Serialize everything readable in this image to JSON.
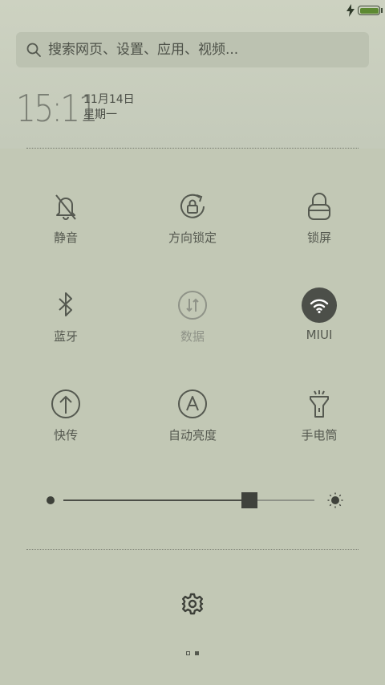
{
  "status_bar": {
    "charging_icon": "lightning-bolt-icon",
    "battery_level_percent": 100,
    "battery_color": "#5d8a32"
  },
  "search": {
    "placeholder": "搜索网页、设置、应用、视频...",
    "icon": "search-icon"
  },
  "clock": {
    "time": "15:11",
    "date": "11月14日",
    "weekday": "星期一"
  },
  "toggles": [
    {
      "id": "silent",
      "label": "静音",
      "icon": "bell-off-icon",
      "enabled": true
    },
    {
      "id": "rotation-lock",
      "label": "方向锁定",
      "icon": "rotation-lock-icon",
      "enabled": true
    },
    {
      "id": "lock-screen",
      "label": "锁屏",
      "icon": "padlock-icon",
      "enabled": true
    },
    {
      "id": "bluetooth",
      "label": "蓝牙",
      "icon": "bluetooth-icon",
      "enabled": true
    },
    {
      "id": "mobile-data",
      "label": "数据",
      "icon": "data-arrows-icon",
      "enabled": false
    },
    {
      "id": "wifi",
      "label": "MIUI",
      "icon": "wifi-icon",
      "enabled": true,
      "active": true
    },
    {
      "id": "quick-transfer",
      "label": "快传",
      "icon": "upload-arrow-icon",
      "enabled": true
    },
    {
      "id": "auto-brightness",
      "label": "自动亮度",
      "icon": "auto-brightness-icon",
      "enabled": true
    },
    {
      "id": "flashlight",
      "label": "手电筒",
      "icon": "flashlight-icon",
      "enabled": true
    }
  ],
  "brightness": {
    "level_percent": 74,
    "low_icon": "brightness-low-icon",
    "high_icon": "sun-icon"
  },
  "settings": {
    "icon": "gear-icon"
  },
  "pager": {
    "pages": 2,
    "current": 2
  },
  "colors": {
    "background": "#c2c8b5",
    "active_toggle": "#4c4f49",
    "text": "#555950",
    "disabled_text": "#8f9388"
  }
}
